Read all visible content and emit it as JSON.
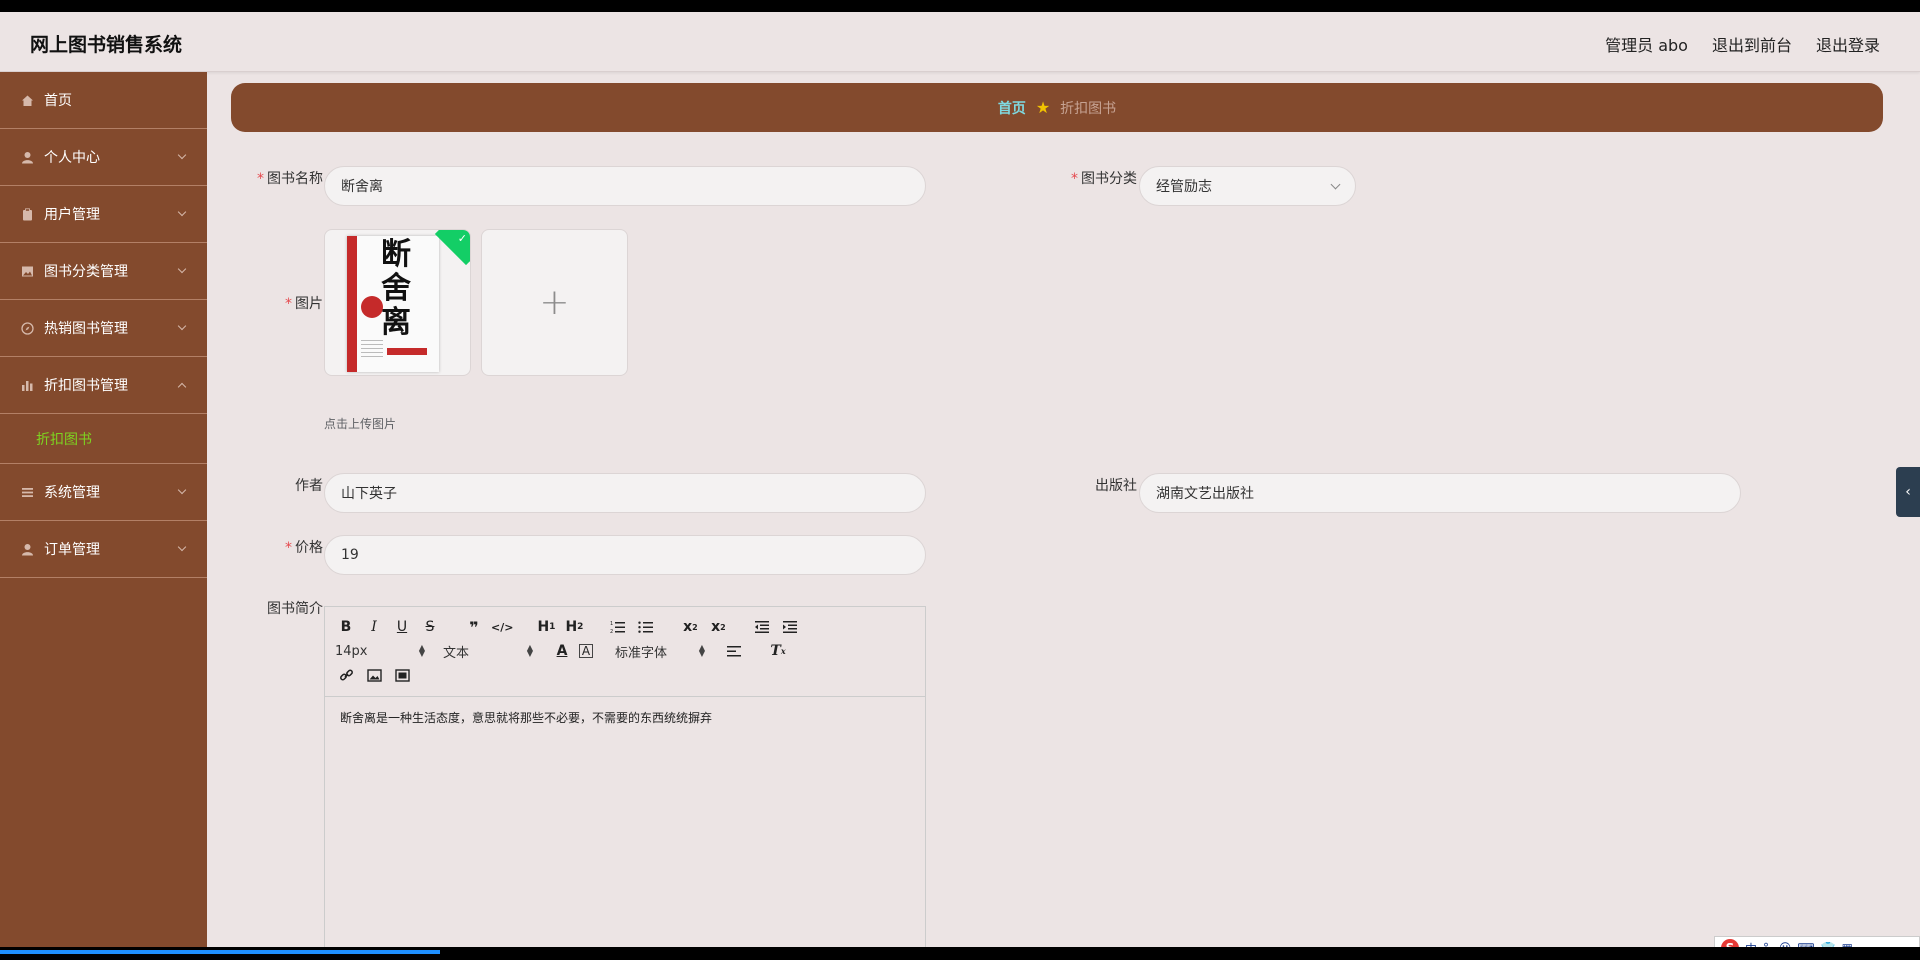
{
  "header": {
    "title": "网上图书销售系统",
    "user": "管理员 abo",
    "to_frontend": "退出到前台",
    "logout": "退出登录"
  },
  "sidebar": {
    "items": [
      {
        "label": "首页",
        "icon": "home-icon"
      },
      {
        "label": "个人中心",
        "icon": "user-icon"
      },
      {
        "label": "用户管理",
        "icon": "clipboard-icon"
      },
      {
        "label": "图书分类管理",
        "icon": "picture-icon"
      },
      {
        "label": "热销图书管理",
        "icon": "compass-icon"
      },
      {
        "label": "折扣图书管理",
        "icon": "bar-chart-icon"
      },
      {
        "label": "系统管理",
        "icon": "list-icon"
      },
      {
        "label": "订单管理",
        "icon": "user-icon"
      }
    ],
    "active_sub": "折扣图书"
  },
  "breadcrumb": {
    "home": "首页",
    "current": "折扣图书"
  },
  "form": {
    "book_name_label": "图书名称",
    "book_name_value": "断舍离",
    "category_label": "图书分类",
    "category_value": "经管励志",
    "image_label": "图片",
    "upload_tip": "点击上传图片",
    "cover_title": [
      "断",
      "舍",
      "离"
    ],
    "author_label": "作者",
    "author_value": "山下英子",
    "publisher_label": "出版社",
    "publisher_value": "湖南文艺出版社",
    "price_label": "价格",
    "price_value": "19",
    "intro_label": "图书简介"
  },
  "editor": {
    "font_size": "14px",
    "text_type": "文本",
    "font_family": "标准字体",
    "content": "断舍离是一种生活态度，意思就将那些不必要，不需要的东西统统摒弃"
  },
  "ime": {
    "label": "中"
  },
  "colors": {
    "sidebar_bg": "#834a2d",
    "page_bg": "#ece4e4",
    "active_sub": "#7ed321",
    "breadcrumb_home": "#7fd9e0",
    "required": "#e5484d"
  }
}
